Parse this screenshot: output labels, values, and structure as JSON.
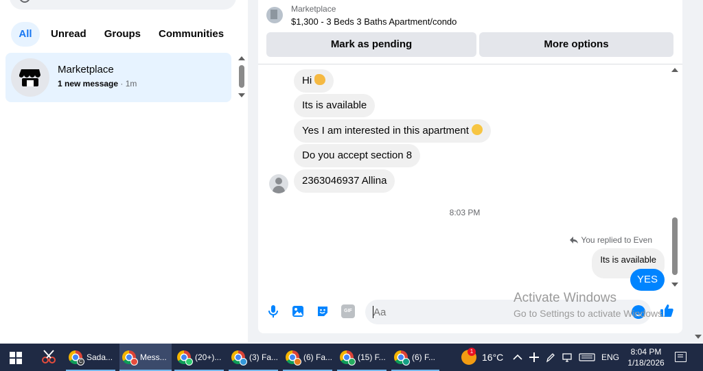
{
  "sidebar": {
    "tabs": [
      {
        "label": "All",
        "active": true
      },
      {
        "label": "Unread",
        "active": false
      },
      {
        "label": "Groups",
        "active": false
      },
      {
        "label": "Communities",
        "active": false
      }
    ],
    "chat": {
      "name": "Marketplace",
      "status": "1 new message",
      "separator": " · ",
      "time": "1m",
      "icon": "shop-icon"
    }
  },
  "header": {
    "label": "Marketplace",
    "title": "$1,300 - 3 Beds 3 Baths Apartment/condo",
    "mark_pending": "Mark as pending",
    "more_options": "More options"
  },
  "messages": {
    "received": [
      {
        "text": "Hi",
        "emoji": "waving-hand"
      },
      {
        "text": "Its is available"
      },
      {
        "text": "Yes I am interested in this apartment",
        "emoji": "smiling-face"
      },
      {
        "text": "Do you accept section 8"
      },
      {
        "text": "2363046937 Allina"
      }
    ],
    "timestamp": "8:03 PM",
    "reply_note": "You replied to Even",
    "quoted": "Its is available",
    "sent": "YES"
  },
  "composer": {
    "placeholder": "Aa",
    "tools": [
      "microphone-icon",
      "image-icon",
      "sticker-icon",
      "gif-icon"
    ],
    "gif_label": "GIF"
  },
  "watermark": {
    "line1": "Activate Windows",
    "line2": "Go to Settings to activate Windows."
  },
  "taskbar": {
    "items": [
      {
        "label": "Sada...",
        "badge": "C",
        "active": false
      },
      {
        "label": "Mess...",
        "active": true
      },
      {
        "label": "(20+)...",
        "active": false
      },
      {
        "label": "(3) Fa...",
        "active": false
      },
      {
        "label": "(6) Fa...",
        "active": false
      },
      {
        "label": "(15) F...",
        "active": false
      },
      {
        "label": "(6) F...",
        "active": false
      }
    ],
    "weather_badge": "1",
    "temperature": "16°C",
    "language": "ENG",
    "time": "8:04 PM",
    "date": "1/18/2026"
  },
  "colors": {
    "accent": "#1877f2",
    "sent_bubble": "#0084ff",
    "taskbar": "#1f2a44"
  }
}
